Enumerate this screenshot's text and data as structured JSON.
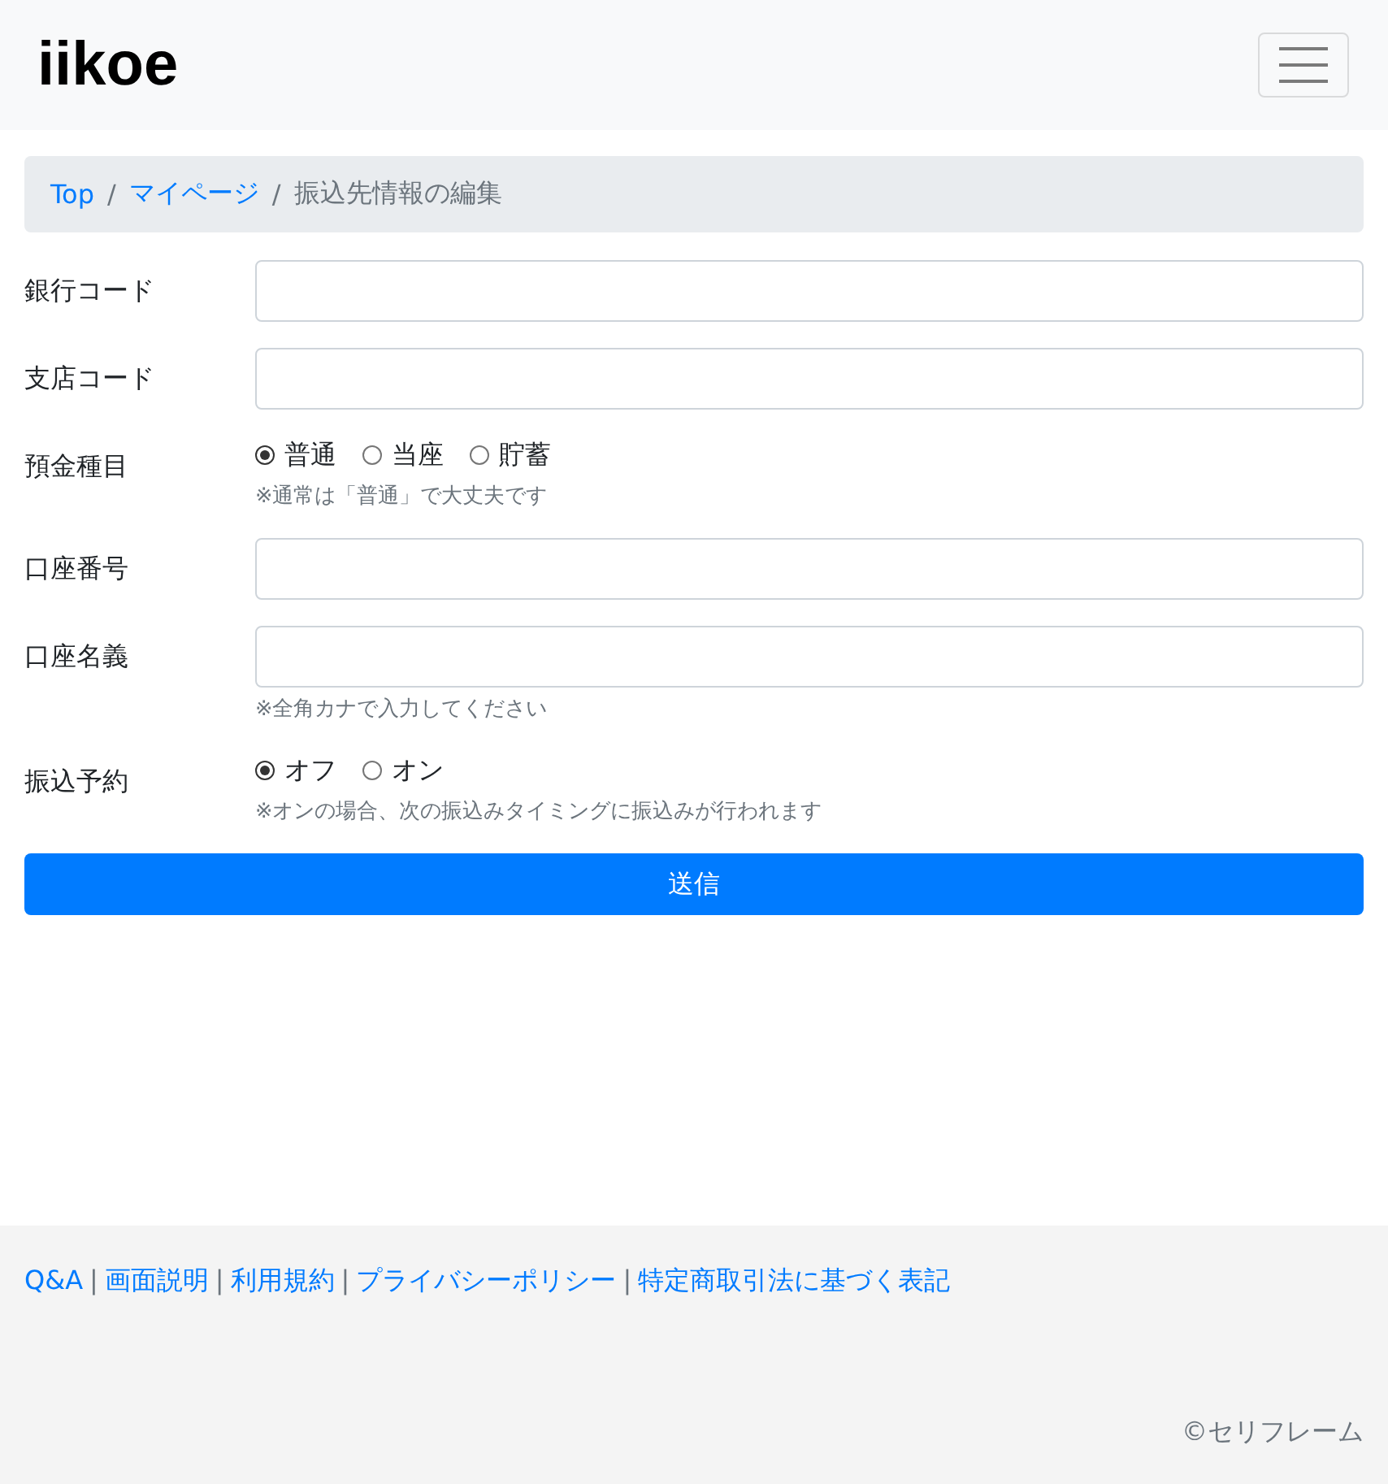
{
  "header": {
    "logo": "iikoe"
  },
  "breadcrumb": [
    {
      "label": "Top",
      "kind": "link"
    },
    {
      "label": "マイページ",
      "kind": "link",
      "separator": "/"
    },
    {
      "label": "振込先情報の編集",
      "kind": "current",
      "separator": "/"
    }
  ],
  "form": {
    "fields": [
      {
        "kind": "text",
        "label": "銀行コード"
      },
      {
        "kind": "text",
        "label": "支店コード"
      },
      {
        "kind": "radio",
        "label": "預金種目",
        "options": [
          {
            "label": "普通",
            "selected": true
          },
          {
            "label": "当座",
            "selected": false
          },
          {
            "label": "貯蓄",
            "selected": false
          }
        ],
        "hint": "※通常は「普通」で大丈夫です"
      },
      {
        "kind": "text",
        "label": "口座番号"
      },
      {
        "kind": "text",
        "label": "口座名義",
        "hint": "※全角カナで入力してください"
      },
      {
        "kind": "radio",
        "label": "振込予約",
        "options": [
          {
            "label": "オフ",
            "selected": true
          },
          {
            "label": "オン",
            "selected": false
          }
        ],
        "hint": "※オンの場合、次の振込みタイミングに振込みが行われます"
      }
    ],
    "submit": "送信"
  },
  "footer": {
    "links": [
      {
        "label": "Q&A"
      },
      {
        "label": "画面説明",
        "separator": "|"
      },
      {
        "label": "利用規約",
        "separator": "|"
      },
      {
        "label": "プライバシーポリシー",
        "separator": "|"
      },
      {
        "label": "特定商取引法に基づく表記",
        "separator": "|"
      }
    ],
    "copyright": "©セリフレーム"
  }
}
